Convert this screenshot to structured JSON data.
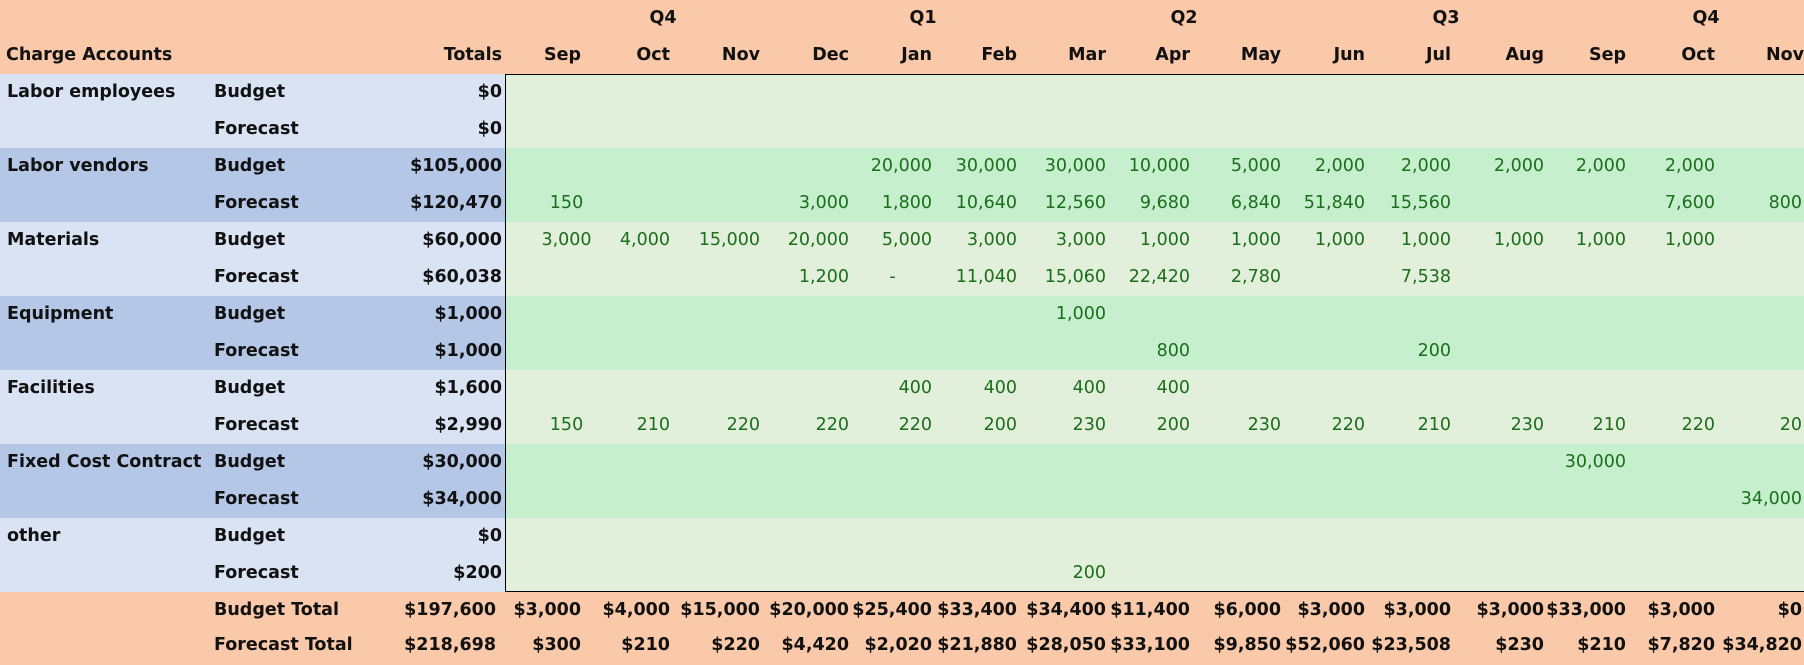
{
  "colors": {
    "header_bg": "#F9C9A9",
    "label_light": "#DAE3F3",
    "label_dark": "#B4C7E7",
    "data_light": "#E2EFDA",
    "data_dark": "#C6EFCE",
    "value_text": "#1B6E1B"
  },
  "header": {
    "charge_accounts": "Charge Accounts",
    "totals": "Totals",
    "quarters": [
      "Q4",
      "Q1",
      "Q2",
      "Q3",
      "Q4"
    ],
    "months": [
      "Sep",
      "Oct",
      "Nov",
      "Dec",
      "Jan",
      "Feb",
      "Mar",
      "Apr",
      "May",
      "Jun",
      "Jul",
      "Aug",
      "Sep",
      "Oct",
      "Nov"
    ]
  },
  "rows": [
    {
      "account": "Labor employees",
      "type": "Budget",
      "total": "$0",
      "values": [
        "",
        "",
        "",
        "",
        "",
        "",
        "",
        "",
        "",
        "",
        "",
        "",
        "",
        "",
        ""
      ]
    },
    {
      "account": "",
      "type": "Forecast",
      "total": "$0",
      "values": [
        "",
        "",
        "",
        "",
        "",
        "",
        "",
        "",
        "",
        "",
        "",
        "",
        "",
        "",
        ""
      ]
    },
    {
      "account": "Labor vendors",
      "type": "Budget",
      "total": "$105,000",
      "values": [
        "",
        "",
        "",
        "",
        "20,000",
        "30,000",
        "30,000",
        "10,000",
        "5,000",
        "2,000",
        "2,000",
        "2,000",
        "2,000",
        "2,000",
        ""
      ]
    },
    {
      "account": "",
      "type": "Forecast",
      "total": "$120,470",
      "values": [
        "150",
        "",
        "",
        "3,000",
        "1,800",
        "10,640",
        "12,560",
        "9,680",
        "6,840",
        "51,840",
        "15,560",
        "",
        "",
        "7,600",
        "800"
      ]
    },
    {
      "account": "Materials",
      "type": "Budget",
      "total": "$60,000",
      "values": [
        "3,000",
        "4,000",
        "15,000",
        "20,000",
        "5,000",
        "3,000",
        "3,000",
        "1,000",
        "1,000",
        "1,000",
        "1,000",
        "1,000",
        "1,000",
        "1,000",
        ""
      ]
    },
    {
      "account": "",
      "type": "Forecast",
      "total": "$60,038",
      "values": [
        "",
        "",
        "",
        "1,200",
        "-",
        "11,040",
        "15,060",
        "22,420",
        "2,780",
        "",
        "7,538",
        "",
        "",
        "",
        ""
      ]
    },
    {
      "account": "Equipment",
      "type": "Budget",
      "total": "$1,000",
      "values": [
        "",
        "",
        "",
        "",
        "",
        "",
        "1,000",
        "",
        "",
        "",
        "",
        "",
        "",
        "",
        ""
      ]
    },
    {
      "account": "",
      "type": "Forecast",
      "total": "$1,000",
      "values": [
        "",
        "",
        "",
        "",
        "",
        "",
        "",
        "800",
        "",
        "",
        "200",
        "",
        "",
        "",
        ""
      ]
    },
    {
      "account": "Facilities",
      "type": "Budget",
      "total": "$1,600",
      "values": [
        "",
        "",
        "",
        "",
        "400",
        "400",
        "400",
        "400",
        "",
        "",
        "",
        "",
        "",
        "",
        ""
      ]
    },
    {
      "account": "",
      "type": "Forecast",
      "total": "$2,990",
      "values": [
        "150",
        "210",
        "220",
        "220",
        "220",
        "200",
        "230",
        "200",
        "230",
        "220",
        "210",
        "230",
        "210",
        "220",
        "20"
      ]
    },
    {
      "account": "Fixed Cost Contract",
      "type": "Budget",
      "total": "$30,000",
      "values": [
        "",
        "",
        "",
        "",
        "",
        "",
        "",
        "",
        "",
        "",
        "",
        "",
        "30,000",
        "",
        ""
      ]
    },
    {
      "account": "",
      "type": "Forecast",
      "total": "$34,000",
      "values": [
        "",
        "",
        "",
        "",
        "",
        "",
        "",
        "",
        "",
        "",
        "",
        "",
        "",
        "",
        "34,000"
      ]
    },
    {
      "account": "other",
      "type": "Budget",
      "total": "$0",
      "values": [
        "",
        "",
        "",
        "",
        "",
        "",
        "",
        "",
        "",
        "",
        "",
        "",
        "",
        "",
        ""
      ]
    },
    {
      "account": "",
      "type": "Forecast",
      "total": "$200",
      "values": [
        "",
        "",
        "",
        "",
        "",
        "",
        "200",
        "",
        "",
        "",
        "",
        "",
        "",
        "",
        ""
      ]
    }
  ],
  "totals": [
    {
      "label": "Budget Total",
      "total": "$197,600",
      "values": [
        "$3,000",
        "$4,000",
        "$15,000",
        "$20,000",
        "$25,400",
        "$33,400",
        "$34,400",
        "$11,400",
        "$6,000",
        "$3,000",
        "$3,000",
        "$3,000",
        "$33,000",
        "$3,000",
        "$0"
      ]
    },
    {
      "label": "Forecast Total",
      "total": "$218,698",
      "values": [
        "$300",
        "$210",
        "$220",
        "$4,420",
        "$2,020",
        "$21,880",
        "$28,050",
        "$33,100",
        "$9,850",
        "$52,060",
        "$23,508",
        "$230",
        "$210",
        "$7,820",
        "$34,820"
      ]
    }
  ]
}
